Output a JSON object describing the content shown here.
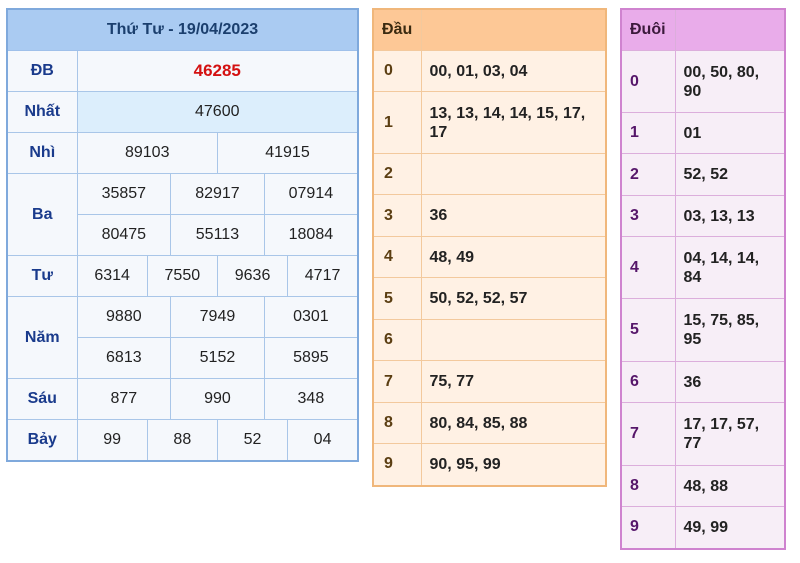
{
  "results": {
    "title": "Thứ Tư - 19/04/2023",
    "rows": [
      {
        "label": "ĐB",
        "values": [
          "46285"
        ]
      },
      {
        "label": "Nhất",
        "values": [
          "47600"
        ]
      },
      {
        "label": "Nhì",
        "values": [
          "89103",
          "41915"
        ]
      },
      {
        "label": "Ba",
        "values": [
          "35857",
          "82917",
          "07914",
          "80475",
          "55113",
          "18084"
        ]
      },
      {
        "label": "Tư",
        "values": [
          "6314",
          "7550",
          "9636",
          "4717"
        ]
      },
      {
        "label": "Năm",
        "values": [
          "9880",
          "7949",
          "0301",
          "6813",
          "5152",
          "5895"
        ]
      },
      {
        "label": "Sáu",
        "values": [
          "877",
          "990",
          "348"
        ]
      },
      {
        "label": "Bảy",
        "values": [
          "99",
          "88",
          "52",
          "04"
        ]
      }
    ]
  },
  "dau": {
    "header": "Đầu",
    "rows": [
      {
        "key": "0",
        "value": "00, 01, 03, 04"
      },
      {
        "key": "1",
        "value": "13, 13, 14, 14, 15, 17, 17"
      },
      {
        "key": "2",
        "value": ""
      },
      {
        "key": "3",
        "value": "36"
      },
      {
        "key": "4",
        "value": "48, 49"
      },
      {
        "key": "5",
        "value": "50, 52, 52, 57"
      },
      {
        "key": "6",
        "value": ""
      },
      {
        "key": "7",
        "value": "75, 77"
      },
      {
        "key": "8",
        "value": "80, 84, 85, 88"
      },
      {
        "key": "9",
        "value": "90, 95, 99"
      }
    ]
  },
  "duoi": {
    "header": "Đuôi",
    "rows": [
      {
        "key": "0",
        "value": "00, 50, 80, 90"
      },
      {
        "key": "1",
        "value": "01"
      },
      {
        "key": "2",
        "value": "52, 52"
      },
      {
        "key": "3",
        "value": "03, 13, 13"
      },
      {
        "key": "4",
        "value": "04, 14, 14, 84"
      },
      {
        "key": "5",
        "value": "15, 75, 85, 95"
      },
      {
        "key": "6",
        "value": "36"
      },
      {
        "key": "7",
        "value": "17, 17, 57, 77"
      },
      {
        "key": "8",
        "value": "48, 88"
      },
      {
        "key": "9",
        "value": "49, 99"
      }
    ]
  },
  "colors": {
    "special_prize": "#d41111",
    "results_header": "#aacbf2",
    "dau_header": "#fdc896",
    "duoi_header": "#e9acea"
  }
}
